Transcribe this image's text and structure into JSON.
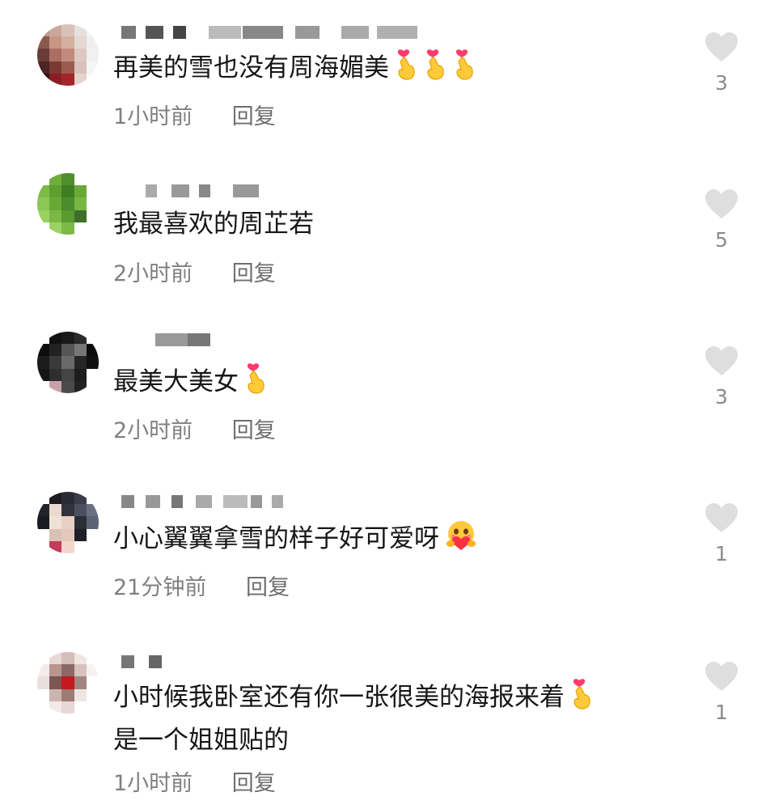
{
  "comments": [
    {
      "text": "再美的雪也没有周海媚美",
      "emojis": [
        "finger-heart",
        "finger-heart",
        "finger-heart"
      ],
      "time": "1小时前",
      "reply": "回复",
      "likes": "3",
      "avatar_colors": [
        "#b79a8c",
        "#c7a89a",
        "#d9c3b8",
        "#e8e0dc",
        "#f2f2f2",
        "#8a5a4e",
        "#c79684",
        "#d4b0a1",
        "#e5d8d2",
        "#eeeeee",
        "#6c3b35",
        "#a86f62",
        "#c08b7d",
        "#ddc9c2",
        "#f0f0f0",
        "#4a2523",
        "#7a3a33",
        "#9d5b4f",
        "#d8c2bb",
        "#f5f5f5",
        "#2d1515",
        "#8b1d24",
        "#a3252c",
        "#e5d3cf",
        "#fafafa"
      ]
    },
    {
      "text": "我最喜欢的周芷若",
      "emojis": [],
      "time": "2小时前",
      "reply": "回复",
      "likes": "5",
      "avatar_colors": [
        "#ffffff",
        "#6fae3a",
        "#4f8f2c",
        "#ffffff",
        "#ffffff",
        "#7cbb45",
        "#5f9f32",
        "#3f7f22",
        "#6aa838",
        "#ffffff",
        "#8bc754",
        "#6aa836",
        "#4c8c2a",
        "#79b543",
        "#ffffff",
        "#9ad160",
        "#7ab843",
        "#5a9a30",
        "#3e6e2a",
        "#ffffff",
        "#ffffff",
        "#9cd263",
        "#7cb946",
        "#ffffff",
        "#ffffff"
      ]
    },
    {
      "text": "最美大美女",
      "emojis": [
        "finger-heart"
      ],
      "time": "2小时前",
      "reply": "回复",
      "likes": "3",
      "avatar_colors": [
        "#ffffff",
        "#111111",
        "#1a1a1a",
        "#2a2a2a",
        "#ffffff",
        "#0d0d0d",
        "#222222",
        "#555555",
        "#777777",
        "#0c0c0c",
        "#1b1b1b",
        "#3a3a3a",
        "#6a6a6a",
        "#262626",
        "#101010",
        "#151515",
        "#2e2e2e",
        "#444444",
        "#1d1d1d",
        "#ffffff",
        "#ffffff",
        "#c8a0a8",
        "#4a4a4a",
        "#222222",
        "#ffffff"
      ]
    },
    {
      "text": "小心翼翼拿雪的样子好可爱呀",
      "emojis": [
        "hug"
      ],
      "time": "21分钟前",
      "reply": "回复",
      "likes": "1",
      "avatar_colors": [
        "#ffffff",
        "#1c1c20",
        "#2a2a34",
        "#3a3e4a",
        "#ffffff",
        "#23242b",
        "#e9d8cf",
        "#31323b",
        "#4b5060",
        "#6a7080",
        "#1a1b21",
        "#f0e0d6",
        "#e8d1c4",
        "#2c2e36",
        "#5b6272",
        "#ffffff",
        "#d9c1b5",
        "#e3c9ba",
        "#1f2027",
        "#ffffff",
        "#ffffff",
        "#c63b5a",
        "#f2d6cc",
        "#ffffff",
        "#ffffff"
      ]
    },
    {
      "text": "小时候我卧室还有你一张很美的海报来着",
      "text2": "是一个姐姐贴的",
      "emojis": [
        "finger-heart"
      ],
      "time": "1小时前",
      "reply": "回复",
      "likes": "1",
      "avatar_colors": [
        "#ffffff",
        "#e8d8d6",
        "#d5bdb8",
        "#f0e6e4",
        "#ffffff",
        "#f3ecea",
        "#b99590",
        "#8a6a68",
        "#d7c2be",
        "#f7f2f1",
        "#e9dfdd",
        "#7d5552",
        "#c21a1e",
        "#a3847f",
        "#ffffff",
        "#ffffff",
        "#cdb4af",
        "#9e7b76",
        "#efe6e4",
        "#ffffff",
        "#ffffff",
        "#f1eae8",
        "#e5d8d5",
        "#ffffff",
        "#ffffff"
      ]
    }
  ]
}
